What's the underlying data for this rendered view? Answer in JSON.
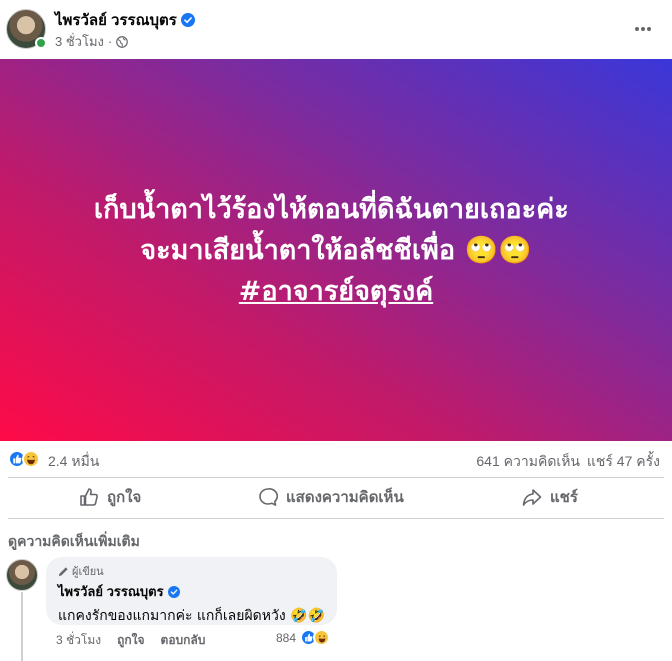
{
  "post": {
    "author": "ไพรวัลย์ วรรณบุตร",
    "time": "3 ชั่วโมง",
    "text_line1": "เก็บน้ำตาไว้ร้องไห้ตอนที่ดิฉันตายเถอะค่ะ ￼",
    "text_line2": "จะมาเสียน้ำตาให้อลัชชีเพื่อ 🙄🙄",
    "hashtag": "#อาจารย์จตุรงค์",
    "background_gradient": [
      "#ff0a48",
      "#c01a6a",
      "#7d2b9e",
      "#3a37d9"
    ]
  },
  "summary": {
    "reactions": "2.4 หมื่น",
    "comments": "641 ความคิดเห็น",
    "shares": "แชร์ 47 ครั้ง"
  },
  "actions": {
    "like": "ถูกใจ",
    "comment": "แสดงความคิดเห็น",
    "share": "แชร์"
  },
  "comments": {
    "view_more": "ดูความคิดเห็นเพิ่มเติม",
    "items": [
      {
        "badge": "ผู้เขียน",
        "name": "ไพรวัลย์ วรรณบุตร",
        "text": "แกคงรักของแกมากค่ะ แกก็เลยผิดหวัง 🤣🤣",
        "time": "3 ชั่วโมง",
        "like": "ถูกใจ",
        "reply": "ตอบกลับ",
        "reaction_count": "884"
      }
    ]
  },
  "colors": {
    "brand_blue": "#1877f2",
    "secondary_text": "#65676b",
    "online_green": "#31a24c"
  },
  "icons": [
    "verified-icon",
    "globe-icon",
    "more-icon",
    "like-icon",
    "comment-icon",
    "share-icon",
    "pen-icon"
  ]
}
